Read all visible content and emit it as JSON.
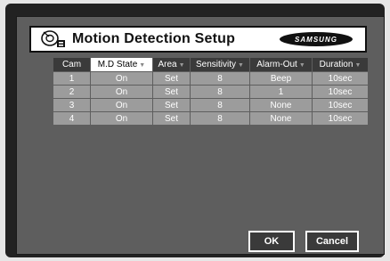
{
  "header": {
    "title": "Motion Detection Setup",
    "brand": "SAMSUNG",
    "icon": "camera-icon"
  },
  "table": {
    "columns": [
      "Cam",
      "M.D State",
      "Area",
      "Sensitivity",
      "Alarm-Out",
      "Duration"
    ],
    "active_column": "M.D State",
    "rows": [
      [
        "1",
        "On",
        "Set",
        "8",
        "Beep",
        "10sec"
      ],
      [
        "2",
        "On",
        "Set",
        "8",
        "1",
        "10sec"
      ],
      [
        "3",
        "On",
        "Set",
        "8",
        "None",
        "10sec"
      ],
      [
        "4",
        "On",
        "Set",
        "8",
        "None",
        "10sec"
      ]
    ]
  },
  "buttons": {
    "ok": "OK",
    "cancel": "Cancel"
  },
  "colors": {
    "panel": "#5e5e5e",
    "header_cell": "#3a3a3a",
    "data_cell": "#9c9c9c",
    "highlight": "#ffffff"
  }
}
